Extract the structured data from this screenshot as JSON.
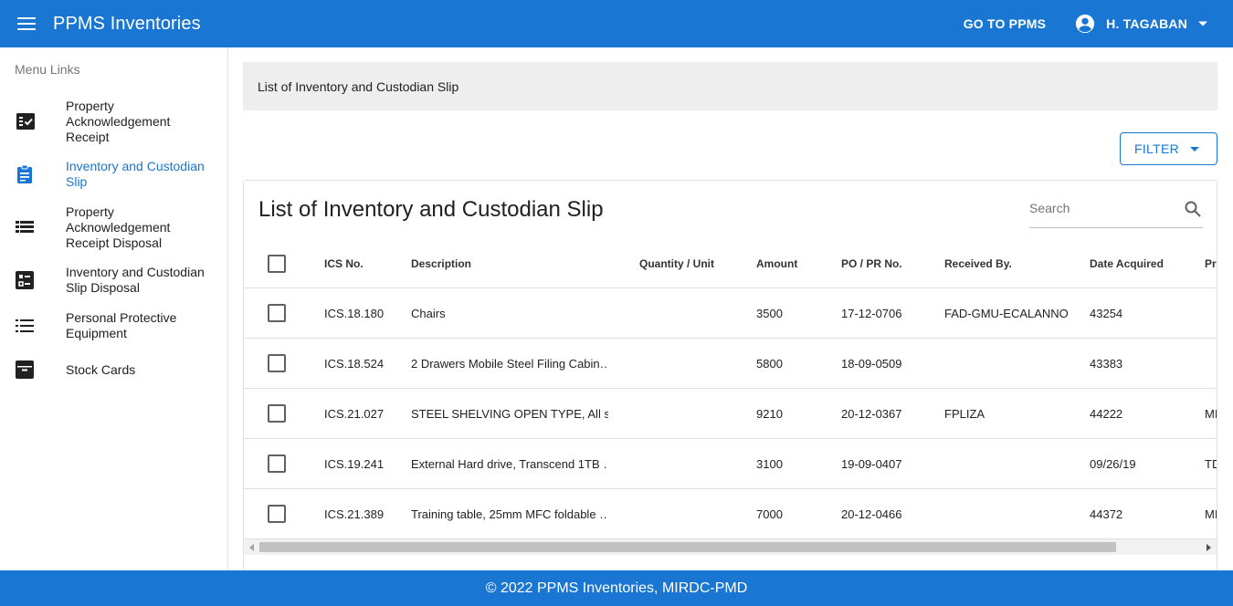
{
  "appbar": {
    "title": "PPMS Inventories",
    "goto_label": "GO TO PPMS",
    "user_name": "H. TAGABAN",
    "menu_icon": "hamburger-icon",
    "user_icon": "account-circle-icon",
    "color": "#1976d2"
  },
  "sidebar": {
    "header": "Menu Links",
    "items": [
      {
        "label": "Property Acknowledgement Receipt",
        "icon": "checklist-icon",
        "active": false
      },
      {
        "label": "Inventory and Custodian Slip",
        "icon": "clipboard-icon",
        "active": true
      },
      {
        "label": "Property Acknowledgement Receipt Disposal",
        "icon": "view-list-icon",
        "active": false
      },
      {
        "label": "Inventory and Custodian Slip Disposal",
        "icon": "ballot-icon",
        "active": false
      },
      {
        "label": "Personal Protective Equipment",
        "icon": "list-icon",
        "active": false
      },
      {
        "label": "Stock Cards",
        "icon": "archive-icon",
        "active": false
      }
    ]
  },
  "breadcrumb": "List of Inventory and Custodian Slip",
  "filter_label": "FILTER",
  "card": {
    "title": "List of Inventory and Custodian Slip",
    "search_placeholder": "Search"
  },
  "table": {
    "headers": {
      "ics": "ICS No.",
      "desc": "Description",
      "qty": "Quantity / Unit",
      "amt": "Amount",
      "po": "PO / PR No.",
      "rec": "Received By.",
      "date": "Date Acquired",
      "extra": "Pr"
    },
    "rows": [
      {
        "ics": "ICS.18.180",
        "desc": "Chairs",
        "qty": "",
        "amt": "3500",
        "po": "17-12-0706",
        "rec": "FAD-GMU-ECALANNO",
        "date": "43254",
        "extra": ""
      },
      {
        "ics": "ICS.18.524",
        "desc": "2 Drawers Mobile Steel Filing Cabin…",
        "qty": "",
        "amt": "5800",
        "po": "18-09-0509",
        "rec": "",
        "date": "43383",
        "extra": ""
      },
      {
        "ics": "ICS.21.027",
        "desc": "STEEL SHELVING OPEN TYPE, All st…",
        "qty": "",
        "amt": "9210",
        "po": "20-12-0367",
        "rec": "FPLIZA",
        "date": "44222",
        "extra": "MI"
      },
      {
        "ics": "ICS.19.241",
        "desc": "External Hard drive, Transcend 1TB …",
        "qty": "",
        "amt": "3100",
        "po": "19-09-0407",
        "rec": "",
        "date": "09/26/19",
        "extra": "TD"
      },
      {
        "ics": "ICS.21.389",
        "desc": "Training table, 25mm MFC foldable …",
        "qty": "",
        "amt": "7000",
        "po": "20-12-0466",
        "rec": "",
        "date": "44372",
        "extra": "MI"
      }
    ]
  },
  "footer": "© 2022 PPMS Inventories, MIRDC-PMD"
}
